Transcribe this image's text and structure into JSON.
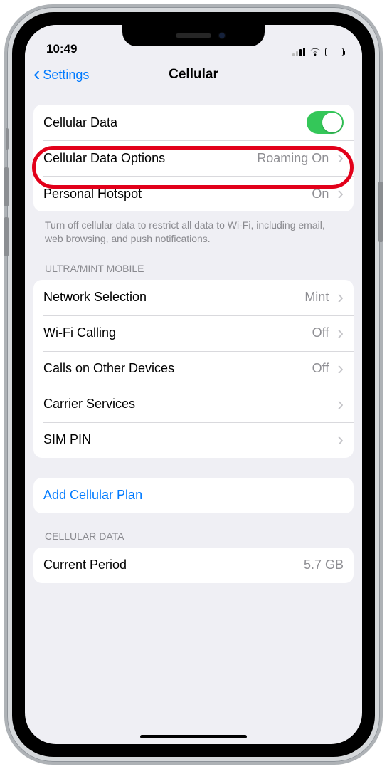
{
  "status": {
    "time": "10:49"
  },
  "nav": {
    "back_label": "Settings",
    "title": "Cellular"
  },
  "group1": {
    "cellular_data": {
      "label": "Cellular Data",
      "on": true
    },
    "data_options": {
      "label": "Cellular Data Options",
      "detail": "Roaming On"
    },
    "hotspot": {
      "label": "Personal Hotspot",
      "detail": "On"
    },
    "note": "Turn off cellular data to restrict all data to Wi-Fi, including email, web browsing, and push notifications."
  },
  "carrier_header": "ULTRA/MINT MOBILE",
  "group2": {
    "network": {
      "label": "Network Selection",
      "detail": "Mint"
    },
    "wifi_calling": {
      "label": "Wi-Fi Calling",
      "detail": "Off"
    },
    "other_calls": {
      "label": "Calls on Other Devices",
      "detail": "Off"
    },
    "carrier_svc": {
      "label": "Carrier Services"
    },
    "sim_pin": {
      "label": "SIM PIN"
    }
  },
  "group3": {
    "add_plan": "Add Cellular Plan"
  },
  "usage_header": "CELLULAR DATA",
  "group4": {
    "current_period": {
      "label": "Current Period",
      "detail": "5.7 GB"
    }
  }
}
